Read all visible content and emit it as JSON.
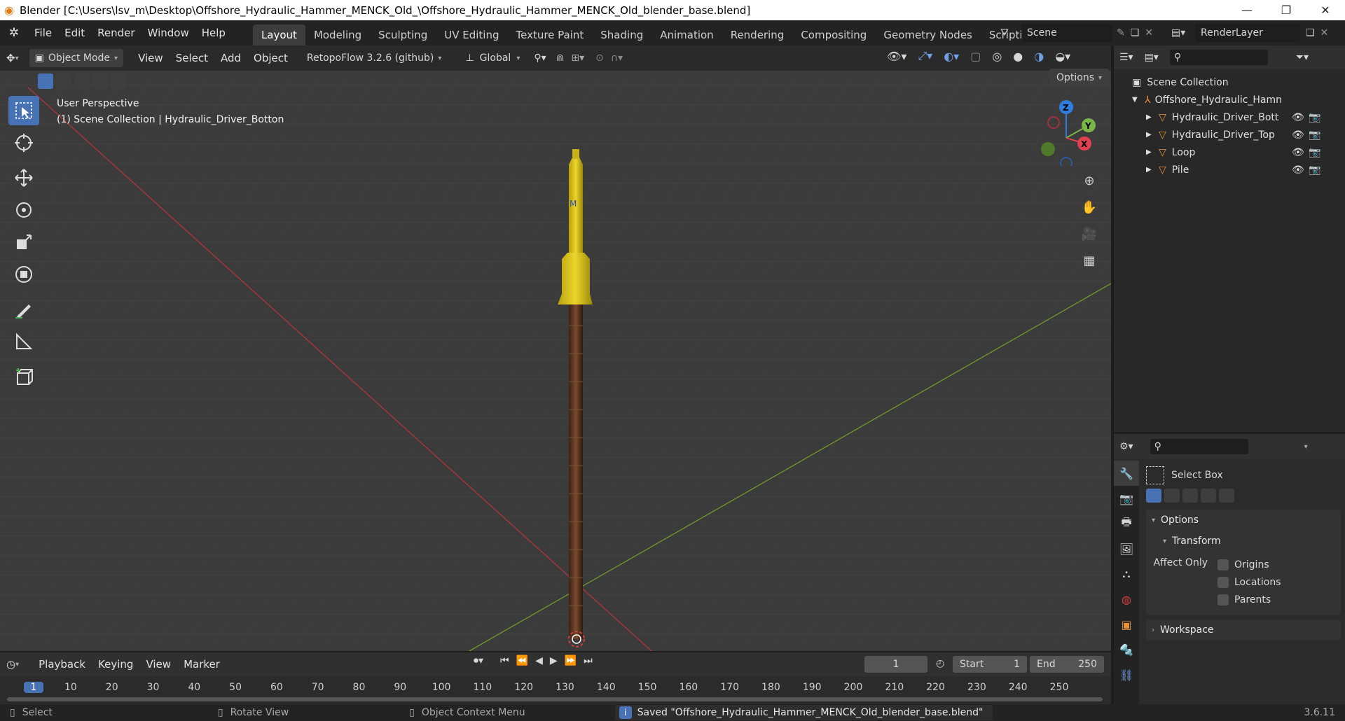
{
  "window": {
    "title": "Blender [C:\\Users\\lsv_m\\Desktop\\Offshore_Hydraulic_Hammer_MENCK_Old_\\Offshore_Hydraulic_Hammer_MENCK_Old_blender_base.blend]"
  },
  "menu": [
    "File",
    "Edit",
    "Render",
    "Window",
    "Help"
  ],
  "workspaces": [
    {
      "label": "Layout",
      "active": true
    },
    {
      "label": "Modeling"
    },
    {
      "label": "Sculpting"
    },
    {
      "label": "UV Editing"
    },
    {
      "label": "Texture Paint"
    },
    {
      "label": "Shading"
    },
    {
      "label": "Animation"
    },
    {
      "label": "Rendering"
    },
    {
      "label": "Compositing"
    },
    {
      "label": "Geometry Nodes"
    },
    {
      "label": "Scripting"
    }
  ],
  "scene": {
    "name": "Scene",
    "render_layer": "RenderLayer"
  },
  "viewport": {
    "mode": "Object Mode",
    "menus": [
      "View",
      "Select",
      "Add",
      "Object"
    ],
    "addon": "RetopoFlow 3.2.6 (github)",
    "orientation": "Global",
    "options": "Options",
    "overlay_line1": "User Perspective",
    "overlay_line2": "(1) Scene Collection | Hydraulic_Driver_Botton",
    "gizmo": {
      "z": "Z",
      "y": "Y",
      "x": "X"
    }
  },
  "outliner": {
    "root": "Scene Collection",
    "collection": "Offshore_Hydraulic_Hamn",
    "items": [
      {
        "label": "Hydraulic_Driver_Bott"
      },
      {
        "label": "Hydraulic_Driver_Top"
      },
      {
        "label": "Loop"
      },
      {
        "label": "Pile"
      }
    ]
  },
  "properties": {
    "tool": "Select Box",
    "options": "Options",
    "transform": "Transform",
    "affect_only": "Affect Only",
    "checks": [
      "Origins",
      "Locations",
      "Parents"
    ],
    "workspace": "Workspace"
  },
  "timeline": {
    "menus": [
      "Playback",
      "Keying",
      "View",
      "Marker"
    ],
    "current": "1",
    "start_label": "Start",
    "start": "1",
    "end_label": "End",
    "end": "250",
    "ticks": [
      "1",
      "10",
      "20",
      "30",
      "40",
      "50",
      "60",
      "70",
      "80",
      "90",
      "100",
      "110",
      "120",
      "130",
      "140",
      "150",
      "160",
      "170",
      "180",
      "190",
      "200",
      "210",
      "220",
      "230",
      "240",
      "250"
    ]
  },
  "status": {
    "select": "Select",
    "rotate": "Rotate View",
    "context": "Object Context Menu",
    "message": "Saved \"Offshore_Hydraulic_Hammer_MENCK_Old_blender_base.blend\"",
    "version": "3.6.11"
  },
  "colors": {
    "accent": "#4772b3",
    "x_axis": "#e04050",
    "y_axis": "#7ab648",
    "z_axis": "#2f7de0",
    "hammer": "#d8c21a",
    "pile": "#5a3621"
  }
}
